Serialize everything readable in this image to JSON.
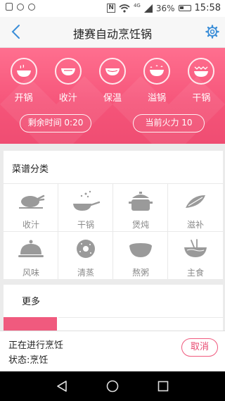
{
  "status_bar": {
    "network": "4G",
    "battery_percent": "36%",
    "time": "15:58",
    "icons": [
      "photo-icon",
      "ring-icon",
      "ring-icon",
      "nfc-icon",
      "wifi-icon",
      "signal-icon",
      "battery-icon"
    ]
  },
  "header": {
    "title": "捷赛自动烹饪锅",
    "back_icon": "chevron-left-icon",
    "settings_icon": "gear-icon"
  },
  "modes": [
    {
      "label": "开锅",
      "icon": "pot-steam-icon"
    },
    {
      "label": "收汁",
      "icon": "bowl-icon"
    },
    {
      "label": "保温",
      "icon": "bowl-warm-icon"
    },
    {
      "label": "溢锅",
      "icon": "pot-overflow-icon"
    },
    {
      "label": "干锅",
      "icon": "dry-pot-icon"
    }
  ],
  "status_pills": {
    "remaining_time": "剩余时间 0:20",
    "current_heat": "当前火力 10"
  },
  "recipes": {
    "title": "菜谱分类",
    "categories": [
      {
        "label": "收汁",
        "icon": "roast-chicken-icon"
      },
      {
        "label": "干锅",
        "icon": "frying-pan-icon"
      },
      {
        "label": "煲炖",
        "icon": "stew-pot-icon"
      },
      {
        "label": "滋补",
        "icon": "herb-icon"
      },
      {
        "label": "风味",
        "icon": "cloche-icon"
      },
      {
        "label": "清蒸",
        "icon": "donut-icon"
      },
      {
        "label": "熬粥",
        "icon": "porridge-bowl-icon"
      },
      {
        "label": "主食",
        "icon": "noodle-bowl-icon"
      }
    ]
  },
  "more": {
    "title": "更多"
  },
  "cooking_panel": {
    "line1": "正在进行烹饪",
    "line2": "状态:烹饪",
    "cancel_label": "取消"
  },
  "nav_bar": {
    "icons": [
      "back-triangle-icon",
      "home-circle-icon",
      "recents-square-icon"
    ]
  },
  "colors": {
    "accent": "#f05a7e",
    "hero_top": "#ff6f8f",
    "hero_bottom": "#ef4d72",
    "icon_gray": "#9a9a9a"
  }
}
